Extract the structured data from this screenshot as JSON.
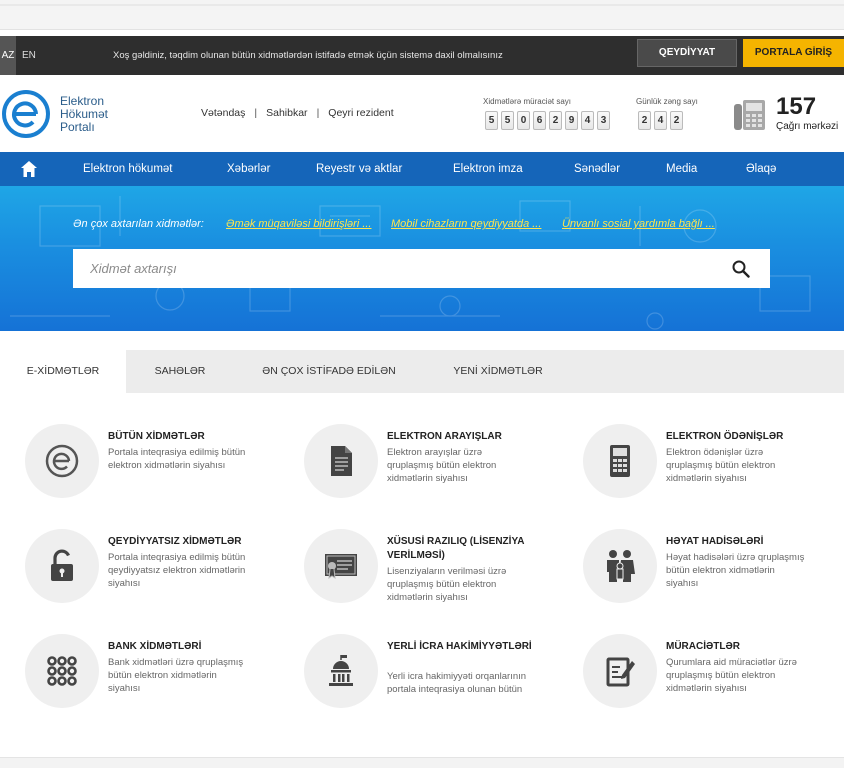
{
  "topbar": {
    "lang_az": "AZ",
    "lang_en": "EN",
    "welcome": "Xoş gəldiniz, təqdim olunan bütün xidmətlərdən istifadə etmək üçün sistemə daxil olmalısınız",
    "register_label": "QEYDİYYAT",
    "login_label": "PORTALA GİRİŞ"
  },
  "header": {
    "logo_line1": "Elektron",
    "logo_line2": "Hökumət",
    "logo_line3": "Portalı",
    "user_types": [
      "Vətəndaş",
      "Sahibkar",
      "Qeyri rezident"
    ],
    "requests_label": "Xidmətlərə müraciət sayı",
    "requests_digits": [
      "5",
      "5",
      "0",
      "6",
      "2",
      "9",
      "4",
      "3"
    ],
    "calls_label": "Günlük zəng sayı",
    "calls_digits": [
      "2",
      "4",
      "2"
    ],
    "callcenter_number": "157",
    "callcenter_label": "Çağrı mərkəzi"
  },
  "nav": {
    "items": [
      "Elektron hökumət",
      "Xəbərlər",
      "Reyestr və aktlar",
      "Elektron imza",
      "Sənədlər",
      "Media",
      "Əlaqə"
    ]
  },
  "hero": {
    "popular_label": "Ən çox axtarılan xidmətlər:",
    "popular_links": [
      "Əmək müqaviləsi bildirişləri ...",
      "Mobil cihazların qeydiyyatda ...",
      "Ünvanlı sosial yardımla bağlı ..."
    ],
    "search_placeholder": "Xidmət axtarışı"
  },
  "tabs": [
    "E-XİDMƏTLƏR",
    "SAHƏLƏR",
    "ƏN ÇOX İSTİFADƏ EDİLƏN",
    "YENİ XİDMƏTLƏR"
  ],
  "services": [
    {
      "title": "BÜTÜN XİDMƏTLƏR",
      "desc": "Portala inteqrasiya edilmiş bütün elektron xidmətlərin siyahısı",
      "icon": "egov-logo-icon"
    },
    {
      "title": "ELEKTRON ARAYIŞLAR",
      "desc": "Elektron arayışlar üzrə qruplaşmış bütün elektron xidmətlərin siyahısı",
      "icon": "document-icon"
    },
    {
      "title": "ELEKTRON ÖDƏNİŞLƏR",
      "desc": "Elektron ödənişlər üzrə qruplaşmış bütün elektron xidmətlərin siyahısı",
      "icon": "calculator-icon"
    },
    {
      "title": "QEYDİYYATSIZ XİDMƏTLƏR",
      "desc": "Portala inteqrasiya edilmiş bütün qeydiyyatsız elektron xidmətlərin siyahısı",
      "icon": "unlock-icon"
    },
    {
      "title": "XÜSUSİ RAZILIQ (LİSENZİYA VERİLMƏSİ)",
      "desc": "Lisenziyaların verilməsi üzrə qruplaşmış bütün elektron xidmətlərin siyahısı",
      "icon": "certificate-icon"
    },
    {
      "title": "HƏYAT HADİSƏLƏRİ",
      "desc": "Həyat hadisələri üzrə qruplaşmış bütün elektron xidmətlərin siyahısı",
      "icon": "family-icon"
    },
    {
      "title": "BANK XİDMƏTLƏRİ",
      "desc": "Bank xidmətləri üzrə qruplaşmış bütün elektron xidmətlərin siyahısı",
      "icon": "grid-dots-icon"
    },
    {
      "title": "YERLİ İCRA HAKİMİYYƏTLƏRİ",
      "desc": "Yerli icra hakimiyyəti orqanlarının portala inteqrasiya olunan bütün",
      "icon": "government-building-icon"
    },
    {
      "title": "MÜRACİƏTLƏR",
      "desc": "Qurumlara aid müraciətlər üzrə qruplaşmış bütün elektron xidmətlərin siyahısı",
      "icon": "edit-note-icon"
    }
  ]
}
